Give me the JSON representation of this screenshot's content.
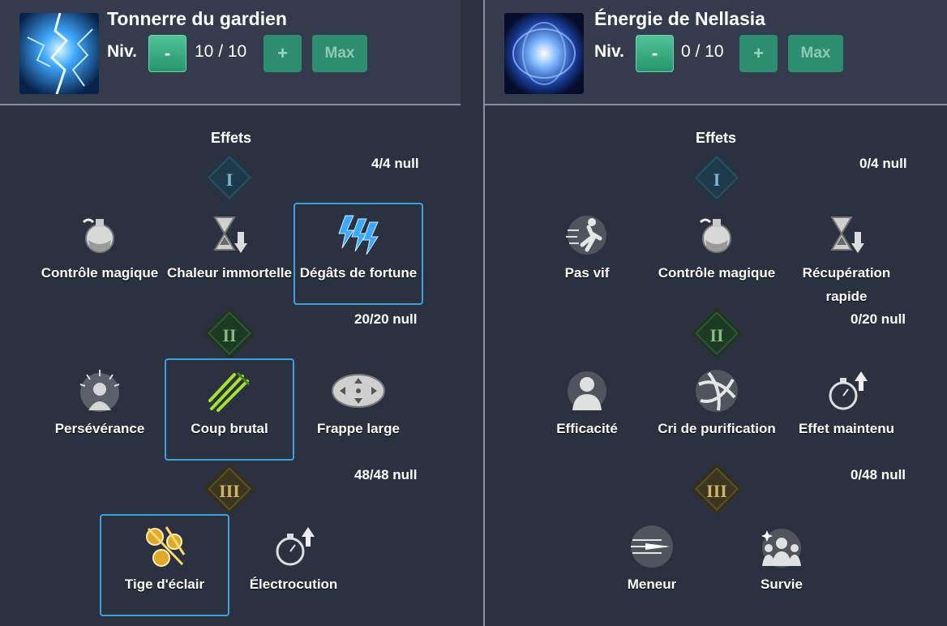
{
  "left": {
    "skill_name": "Tonnerre du gardien",
    "level_label": "Niv.",
    "level_value": "10 / 10",
    "minus_label": "-",
    "plus_label": "+",
    "max_label": "Max",
    "effects_label": "Effets",
    "tiers": [
      {
        "rank": "I",
        "count": "4/4 null",
        "nodes": [
          {
            "label": "Contrôle magique",
            "icon": "potion-icon",
            "selected": false
          },
          {
            "label": "Chaleur immortelle",
            "icon": "hourglass-down-icon",
            "selected": false
          },
          {
            "label": "Dégâts de fortune",
            "icon": "lightning-icon",
            "selected": true
          }
        ]
      },
      {
        "rank": "II",
        "count": "20/20 null",
        "nodes": [
          {
            "label": "Persévérance",
            "icon": "person-aura-icon",
            "selected": false
          },
          {
            "label": "Coup brutal",
            "icon": "slash-icon",
            "selected": true
          },
          {
            "label": "Frappe large",
            "icon": "spread-arrows-icon",
            "selected": false
          }
        ]
      },
      {
        "rank": "III",
        "count": "48/48 null",
        "nodes": [
          {
            "label": "Tige d'éclair",
            "icon": "golden-orbs-icon",
            "selected": true
          },
          {
            "label": "Électrocution",
            "icon": "stopwatch-up-icon",
            "selected": false
          }
        ]
      }
    ]
  },
  "right": {
    "skill_name": "Énergie de Nellasia",
    "level_label": "Niv.",
    "level_value": "0 / 10",
    "minus_label": "-",
    "plus_label": "+",
    "max_label": "Max",
    "effects_label": "Effets",
    "tiers": [
      {
        "rank": "I",
        "count": "0/4 null",
        "nodes": [
          {
            "label": "Pas vif",
            "icon": "running-icon",
            "selected": false
          },
          {
            "label": "Contrôle magique",
            "icon": "potion-icon",
            "selected": false
          },
          {
            "label": "Récupération rapide",
            "icon": "hourglass-down-icon",
            "selected": false
          }
        ]
      },
      {
        "rank": "II",
        "count": "0/20 null",
        "nodes": [
          {
            "label": "Efficacité",
            "icon": "person-icon",
            "selected": false
          },
          {
            "label": "Cri de purification",
            "icon": "swirl-icon",
            "selected": false
          },
          {
            "label": "Effet maintenu",
            "icon": "stopwatch-up-icon",
            "selected": false
          }
        ]
      },
      {
        "rank": "III",
        "count": "0/48 null",
        "nodes": [
          {
            "label": "Meneur",
            "icon": "dash-blade-icon",
            "selected": false
          },
          {
            "label": "Survie",
            "icon": "crowd-icon",
            "selected": false
          }
        ]
      }
    ]
  },
  "colors": {
    "background": "#2b3140",
    "header": "#333b4c",
    "accent": "#2e9a74",
    "selected_border": "#3ba3dc"
  }
}
